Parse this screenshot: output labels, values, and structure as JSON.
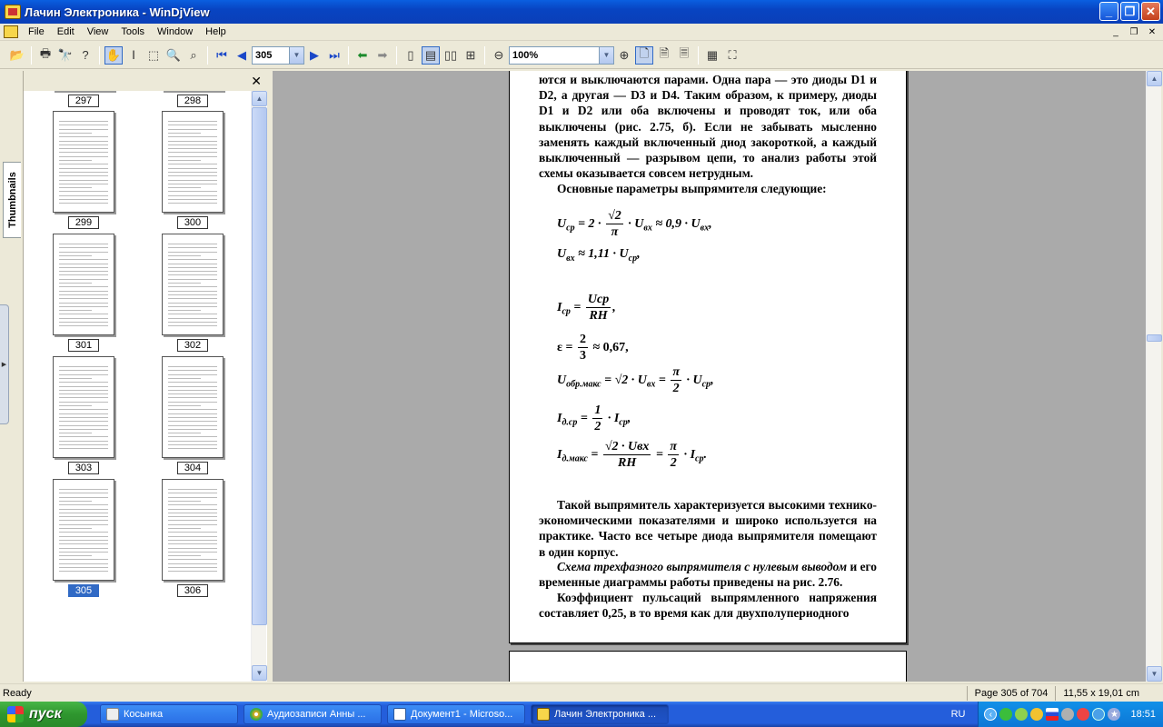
{
  "window": {
    "title": "Лачин Электроника - WinDjView",
    "minimize": "_",
    "maximize": "❐",
    "close": "✕"
  },
  "menu": {
    "items": [
      "File",
      "Edit",
      "View",
      "Tools",
      "Window",
      "Help"
    ],
    "mdi": [
      "_",
      "❐",
      "✕"
    ]
  },
  "toolbar": {
    "page_value": "305",
    "zoom_value": "100%"
  },
  "sidebar": {
    "tab_label": "Thumbnails",
    "close": "✕",
    "thumbnails": [
      "297",
      "298",
      "299",
      "300",
      "301",
      "302",
      "303",
      "304",
      "305",
      "306"
    ],
    "selected": "305"
  },
  "document": {
    "para1": "ются и выключаются парами. Одна пара — это диоды D1 и D2, а другая — D3 и D4. Таким образом, к примеру, диоды D1 и D2 или оба включены и проводят ток, или оба выключены (рис. 2.75, б). Если не забывать мысленно заменять каждый включенный диод закороткой, а каждый выключенный — разрывом цепи, то анализ работы этой схемы оказывается совсем нетрудным.",
    "para2": "Основные параметры выпрямителя следующие:",
    "f1_left": "U",
    "f1_sub": "ср",
    "f1_mid": "= 2 ·",
    "f1_num": "√2",
    "f1_den": "π",
    "f1_right": "· U",
    "f1_sub2": "вх",
    "f1_tail": "≈ 0,9 · U",
    "f1_sub3": "вх",
    "f1_end": ",",
    "f2": "U",
    "f2_sub": "вх",
    "f2_mid": "≈ 1,11 · U",
    "f2_sub2": "ср",
    "f2_end": ",",
    "f3_lhs": "I",
    "f3_sub": "ср",
    "f3_num": "Uср",
    "f3_den": "RН",
    "f3_end": ",",
    "f4_lhs": "ε =",
    "f4_num": "2",
    "f4_den": "3",
    "f4_rhs": "≈ 0,67,",
    "f5_lhs": "U",
    "f5_sub": "обр.макс",
    "f5_mid": "= √2 · U",
    "f5_sub2": "вх",
    "f5_eq": "=",
    "f5_num": "π",
    "f5_den": "2",
    "f5_rhs": "· U",
    "f5_sub3": "ср",
    "f5_end": ",",
    "f6_lhs": "I",
    "f6_sub": "д.ср",
    "f6_num": "1",
    "f6_den": "2",
    "f6_rhs": "· I",
    "f6_sub2": "ср",
    "f6_end": ",",
    "f7_lhs": "I",
    "f7_sub": "д.макс",
    "f7_num": "√2 · Uвх",
    "f7_den": "RН",
    "f7_eq": "=",
    "f7_num2": "π",
    "f7_den2": "2",
    "f7_rhs": "· I",
    "f7_sub2": "ср",
    "f7_end": ".",
    "para3": "Такой выпрямитель характеризуется высокими технико-экономическими показателями и широко используется на практике. Часто все четыре диода выпрямителя помещают в один корпус.",
    "para4_italic": "Схема трехфазного выпрямителя с нулевым выводом",
    "para4_rest": " и его временные диаграммы работы приведены на рис. 2.76.",
    "para5": "Коэффициент пульсаций выпрямленного напряжения составляет 0,25, в то время как для двухполупериодного"
  },
  "status": {
    "ready": "Ready",
    "page": "Page 305 of 704",
    "size": "11,55 x 19,01 cm"
  },
  "taskbar": {
    "start": "пуск",
    "tasks": [
      "Косынка",
      "Аудиозаписи Анны ...",
      "Документ1 - Microso...",
      "Лачин Электроника ..."
    ],
    "lang": "RU",
    "clock": "18:51"
  },
  "colors": {
    "titlebar": "#0a5fe0",
    "taskbar": "#245edb",
    "start": "#2e962e",
    "selection": "#316ac5",
    "viewer_bg": "#aaaaaa"
  }
}
